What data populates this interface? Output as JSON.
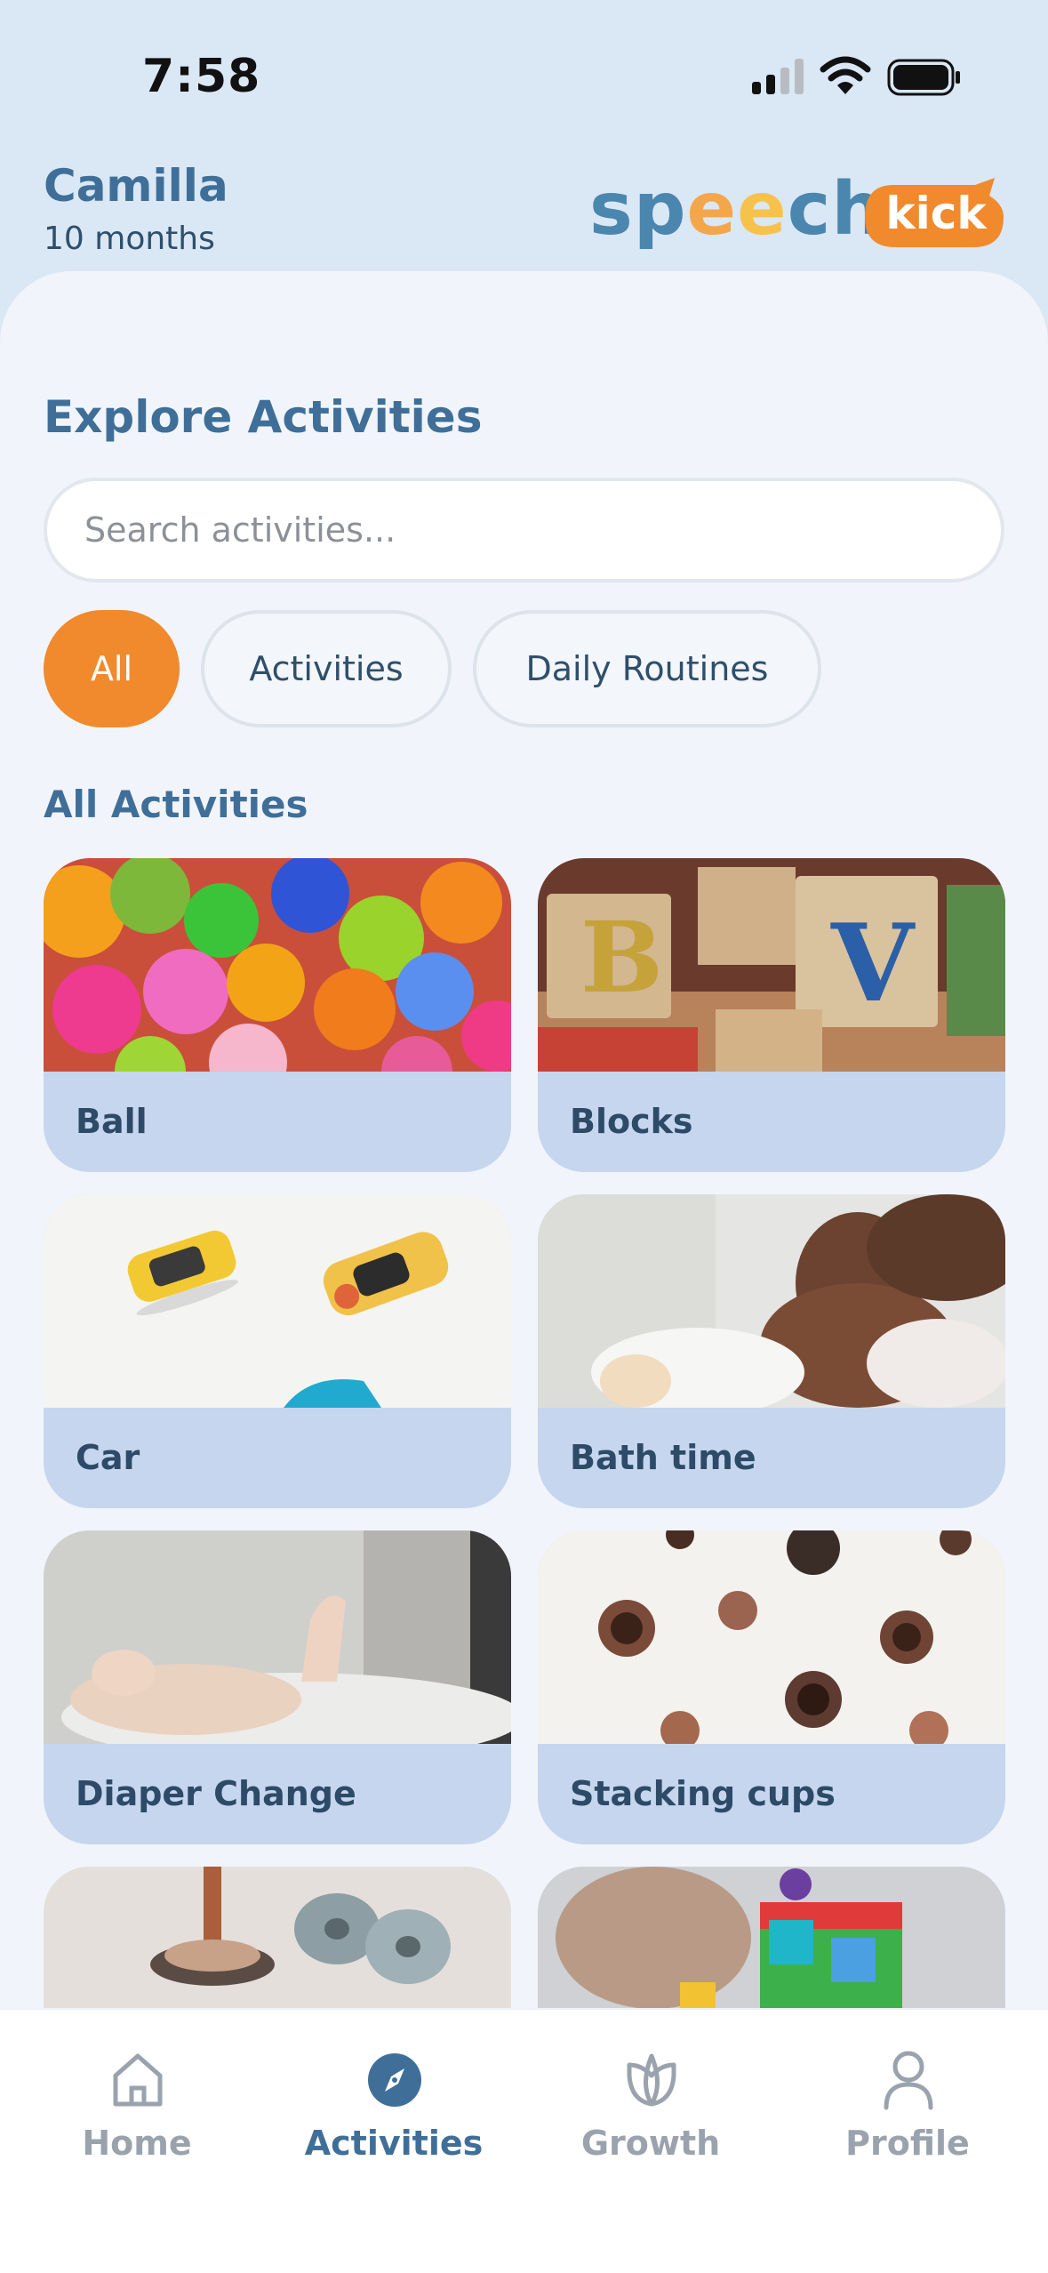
{
  "status_bar": {
    "time": "7:58"
  },
  "header": {
    "child_name": "Camilla",
    "child_age": "10 months",
    "logo": {
      "word": "speech",
      "badge": "kick"
    }
  },
  "explore": {
    "title": "Explore Activities",
    "search_placeholder": "Search activities..."
  },
  "filters": [
    {
      "label": "All",
      "active": true
    },
    {
      "label": "Activities",
      "active": false
    },
    {
      "label": "Daily Routines",
      "active": false
    }
  ],
  "list_title": "All Activities",
  "activities": [
    {
      "label": "Ball",
      "image": "colorful-balls-photo"
    },
    {
      "label": "Blocks",
      "image": "letter-blocks-photo"
    },
    {
      "label": "Car",
      "image": "toy-cars-photo"
    },
    {
      "label": "Bath time",
      "image": "baby-bath-photo"
    },
    {
      "label": "Diaper Change",
      "image": "baby-feet-photo"
    },
    {
      "label": "Stacking cups",
      "image": "stacking-cups-photo"
    },
    {
      "label": "",
      "image": "ring-stacker-photo"
    },
    {
      "label": "",
      "image": "shape-sorter-photo"
    }
  ],
  "tabbar": [
    {
      "label": "Home",
      "icon": "home-icon",
      "active": false
    },
    {
      "label": "Activities",
      "icon": "compass-icon",
      "active": true
    },
    {
      "label": "Growth",
      "icon": "growth-icon",
      "active": false
    },
    {
      "label": "Profile",
      "icon": "profile-icon",
      "active": false
    }
  ],
  "colors": {
    "accent": "#f08a2d",
    "primary": "#3f6f98",
    "card_bg": "#c5d6ee",
    "page_bg": "#dae7f5"
  }
}
